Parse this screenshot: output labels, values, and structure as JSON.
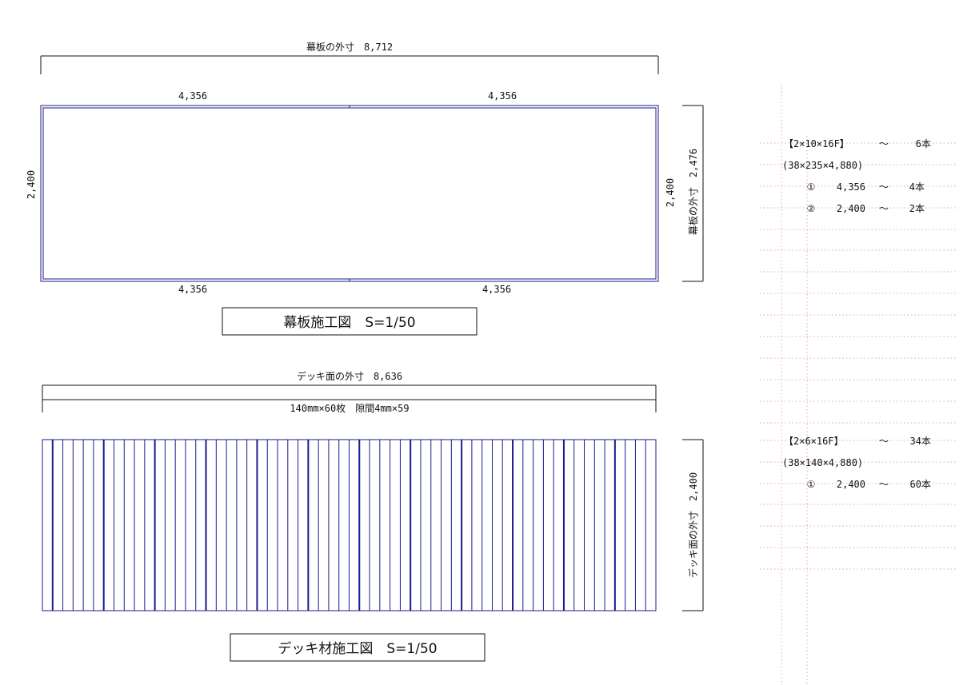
{
  "colors": {
    "drawing": "#1a1a8c",
    "grid": "#e2a0cc",
    "text": "#111111"
  },
  "panel": {
    "dims": {
      "overall_top": "幕板の外寸　8,712",
      "top_left": "4,356",
      "top_right": "4,356",
      "bottom_left": "4,356",
      "bottom_right": "4,356",
      "left_height": "2,400",
      "inner_right_height": "2,400",
      "outer_right_height": "幕板の外寸　2,476"
    },
    "title": "幕板施工図　S=1/50"
  },
  "deck": {
    "dims": {
      "overall_top": "デッキ面の外寸　8,636",
      "boards": "140mm×60枚　隙間4mm×59",
      "outer_right_height": "デッキ面の外寸　2,400"
    },
    "board_count": 60,
    "title": "デッキ材施工図　S=1/50"
  },
  "materials": {
    "group1": {
      "spec": "【2×10×16F】",
      "tilde": "～",
      "qty": "6本",
      "size": "(38×235×4,880)",
      "items": [
        {
          "no": "①",
          "length": "4,356",
          "tilde": "～",
          "qty": "4本"
        },
        {
          "no": "②",
          "length": "2,400",
          "tilde": "～",
          "qty": "2本"
        }
      ]
    },
    "group2": {
      "spec": "【2×6×16F】",
      "tilde": "～",
      "qty": "34本",
      "size": "(38×140×4,880)",
      "items": [
        {
          "no": "①",
          "length": "2,400",
          "tilde": "～",
          "qty": "60本"
        }
      ]
    }
  }
}
